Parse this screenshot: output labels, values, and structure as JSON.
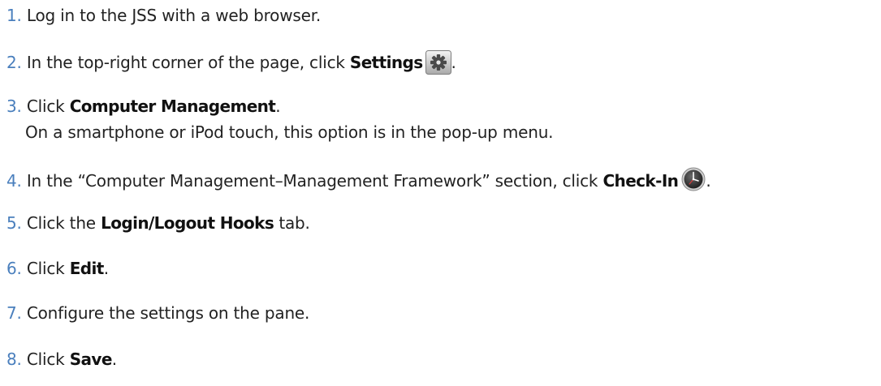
{
  "steps": [
    {
      "num": "1.",
      "pre": "Log in to the JSS with a web browser."
    },
    {
      "num": "2.",
      "pre": "In the top-right corner of the page, click ",
      "bold": "Settings",
      "post": "."
    },
    {
      "num": "3.",
      "pre": "Click ",
      "bold": "Computer Management",
      "post": ".",
      "sub": "On a smartphone or iPod touch, this option is in the pop-up menu."
    },
    {
      "num": "4.",
      "pre": "In the “Computer Management–Management Framework” section, click ",
      "bold": "Check-In",
      "post": "."
    },
    {
      "num": "5.",
      "pre": "Click the ",
      "bold": "Login/Logout Hooks",
      "post": " tab."
    },
    {
      "num": "6.",
      "pre": "Click ",
      "bold": "Edit",
      "post": "."
    },
    {
      "num": "7.",
      "pre": "Configure the settings on the pane."
    },
    {
      "num": "8.",
      "pre": "Click ",
      "bold": "Save",
      "post": "."
    }
  ],
  "icons": {
    "settings": "gear-icon",
    "checkin": "clock-icon"
  },
  "colors": {
    "step_number": "#4a7fbd",
    "text": "#222222"
  }
}
